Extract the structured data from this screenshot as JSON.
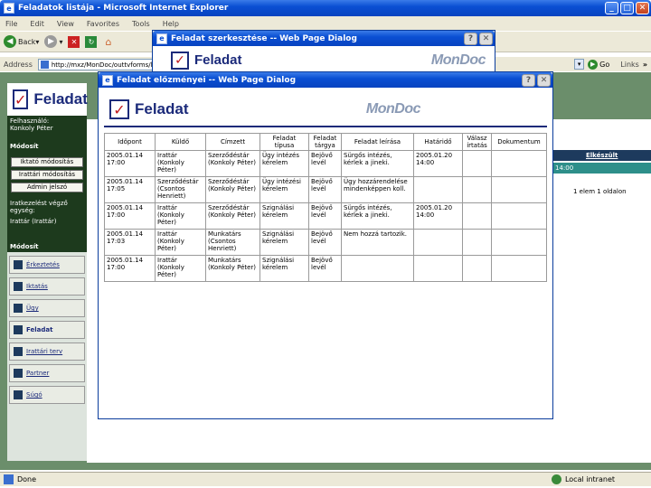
{
  "browser": {
    "title": "Feladatok listája - Microsoft Internet Explorer",
    "menu": [
      "File",
      "Edit",
      "View",
      "Favorites",
      "Tools",
      "Help"
    ],
    "back_label": "Back",
    "address_label": "Address",
    "address_value": "http://mxz/MonDoc/outtvforms/lis",
    "go_label": "Go",
    "links_label": "Links",
    "status_left": "Done",
    "status_right": "Local intranet"
  },
  "app": {
    "logo_text": "Feladat",
    "user_label": "Felhasználó:",
    "user_name": "Konkoly Péter",
    "section_modosit": "Módosít",
    "buttons": [
      "Iktató módosítás",
      "Irattári módosítás",
      "Admin jelszó"
    ],
    "ugyiratkezeles": "Iratkezelést végző egység:",
    "ugyiratkezeles_value": "Irattár (Irattár)",
    "section_modosit2": "Módosít",
    "nav": [
      "Érkeztetés",
      "Iktatás",
      "Ügy",
      "Feladat",
      "Irattári terv",
      "Partner",
      "Súgó"
    ],
    "right_header": "Elkészült",
    "right_cell": "14:00",
    "pager": "1 elem 1 oldalon"
  },
  "dialog_back": {
    "title": "Feladat szerkesztése -- Web Page Dialog",
    "logo_text": "Feladat",
    "brand": "MonDoc"
  },
  "dialog_front": {
    "title": "Feladat előzményei -- Web Page Dialog",
    "logo_text": "Feladat",
    "brand": "MonDoc",
    "columns": [
      "Időpont",
      "Küldő",
      "Címzett",
      "Feladat típusa",
      "Feladat tárgya",
      "Feladat leírása",
      "Határidő",
      "Válasz írtatás",
      "Dokumentum"
    ],
    "rows": [
      [
        "2005.01.14 17:00",
        "Irattár (Konkoly Péter)",
        "Szerződéstár (Konkoly Péter)",
        "Ügy intézés kérelem",
        "Bejövő levél",
        "Sürgős intézés, kérlek a jineki.",
        "2005.01.20 14:00",
        "",
        ""
      ],
      [
        "2005.01.14 17:05",
        "Szerződéstár (Csontos Henriett)",
        "Szerződéstár (Konkoly Péter)",
        "Ügy intézési kérelem",
        "Bejövő levél",
        "Ügy hozzárendelése mindenképpen koll.",
        "",
        "",
        ""
      ],
      [
        "2005.01.14 17:00",
        "Irattár (Konkoly Péter)",
        "Szerződéstár (Konkoly Péter)",
        "Szignálási kérelem",
        "Bejövő levél",
        "Sürgős intézés, kérlek a jineki.",
        "2005.01.20 14:00",
        "",
        ""
      ],
      [
        "2005.01.14 17:03",
        "Irattár (Konkoly Péter)",
        "Munkatárs (Csontos Henriett)",
        "Szignálási kérelem",
        "Bejövő levél",
        "Nem hozzá tartozik.",
        "",
        "",
        ""
      ],
      [
        "2005.01.14 17:00",
        "Irattár (Konkoly Péter)",
        "Munkatárs (Konkoly Péter)",
        "Szignálási kérelem",
        "Bejövő levél",
        "",
        "",
        "",
        ""
      ]
    ]
  }
}
